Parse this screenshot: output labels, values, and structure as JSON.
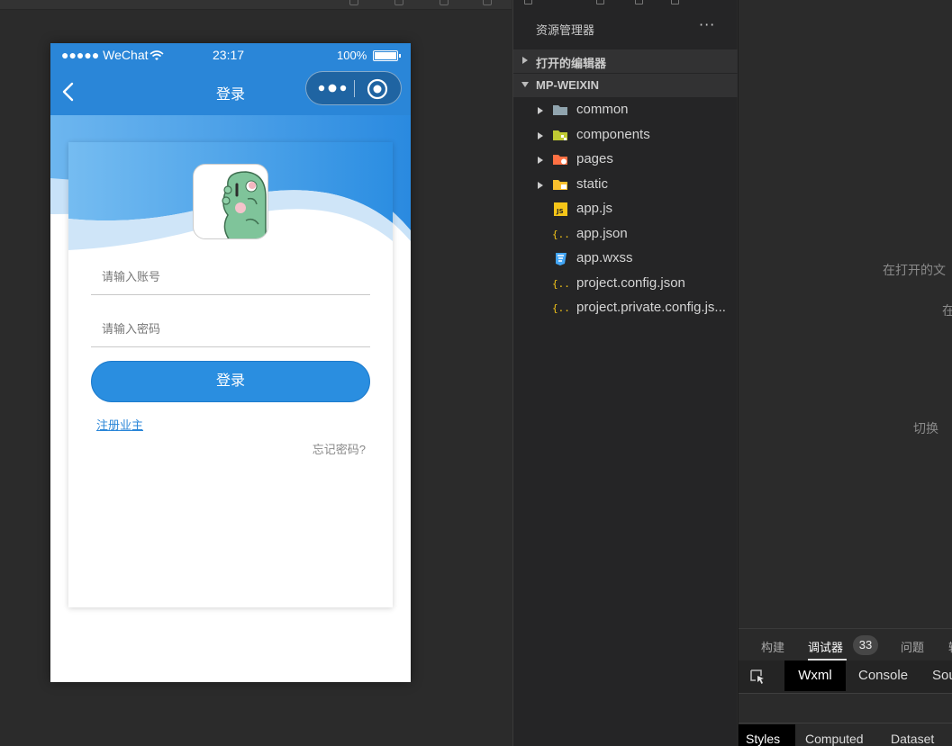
{
  "simulator": {
    "status_bar": {
      "carrier": "●●●●● WeChat",
      "time": "23:17",
      "battery": "100%"
    },
    "nav_bar": {
      "title": "登录"
    },
    "login": {
      "account_placeholder": "请输入账号",
      "password_placeholder": "请输入密码",
      "login_button": "登录",
      "register_link": "注册业主",
      "forgot_link": "忘记密码?"
    }
  },
  "explorer": {
    "title": "资源管理器",
    "more": "···",
    "sections": [
      {
        "label": "打开的编辑器",
        "expanded": false
      },
      {
        "label": "MP-WEIXIN",
        "expanded": true
      }
    ],
    "tree": [
      {
        "name": "common",
        "type": "folder",
        "icon": "folder-icon"
      },
      {
        "name": "components",
        "type": "folder",
        "icon": "components-folder-icon"
      },
      {
        "name": "pages",
        "type": "folder",
        "icon": "pages-folder-icon"
      },
      {
        "name": "static",
        "type": "folder",
        "icon": "static-folder-icon"
      },
      {
        "name": "app.js",
        "type": "file",
        "icon": "js-file-icon"
      },
      {
        "name": "app.json",
        "type": "file",
        "icon": "json-file-icon"
      },
      {
        "name": "app.wxss",
        "type": "file",
        "icon": "css-file-icon"
      },
      {
        "name": "project.config.json",
        "type": "file",
        "icon": "json-file-icon"
      },
      {
        "name": "project.private.config.js...",
        "type": "file",
        "icon": "json-file-icon"
      }
    ]
  },
  "editor": {
    "hints": [
      "在打开的文",
      "在",
      "切换"
    ],
    "devtools_tabs": [
      "构建",
      "调试器",
      "问题",
      "输"
    ],
    "devtools_badge": "33",
    "panel_tabs": [
      "Wxml",
      "Console",
      "Sou"
    ],
    "style_tabs": [
      "Styles",
      "Computed",
      "Dataset"
    ]
  },
  "colors": {
    "brand_blue": "#2a86d8",
    "button_blue": "#2a8ee0",
    "ide_background": "#2b2b2b"
  }
}
